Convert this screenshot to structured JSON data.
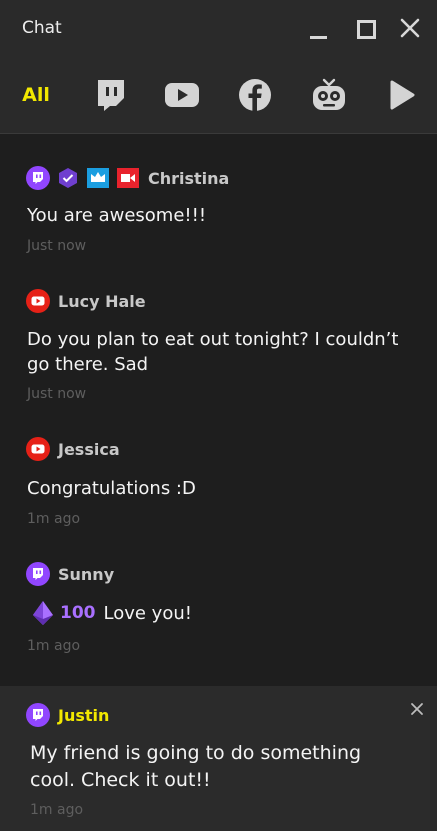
{
  "window": {
    "title": "Chat"
  },
  "filters": {
    "all_label": "All"
  },
  "messages": [
    {
      "author": "Christina",
      "text": "You are awesome!!!",
      "time": "Just now",
      "platform": "twitch",
      "badges": [
        "twitch-icon",
        "verified-icon",
        "crown-icon",
        "video-icon"
      ]
    },
    {
      "author": "Lucy Hale",
      "text": "Do you plan to eat out tonight? I couldn’t go there. Sad",
      "time": "Just now",
      "platform": "youtube"
    },
    {
      "author": "Jessica",
      "text": "Congratulations :D",
      "time": "1m ago",
      "platform": "youtube"
    },
    {
      "author": "Sunny",
      "bits": "100",
      "text": "Love you!",
      "time": "1m ago",
      "platform": "twitch"
    },
    {
      "author": "Justin",
      "text": "My friend is going to do something cool. Check it out!!",
      "time": "1m ago",
      "platform": "twitch",
      "highlighted": true
    }
  ],
  "colors": {
    "background": "#1e1e1e",
    "bar": "#2a2a2a",
    "accent_yellow": "#f2e800",
    "twitch_purple": "#9146ff",
    "youtube_red": "#e62117",
    "muted_text": "#5e5e5e"
  }
}
